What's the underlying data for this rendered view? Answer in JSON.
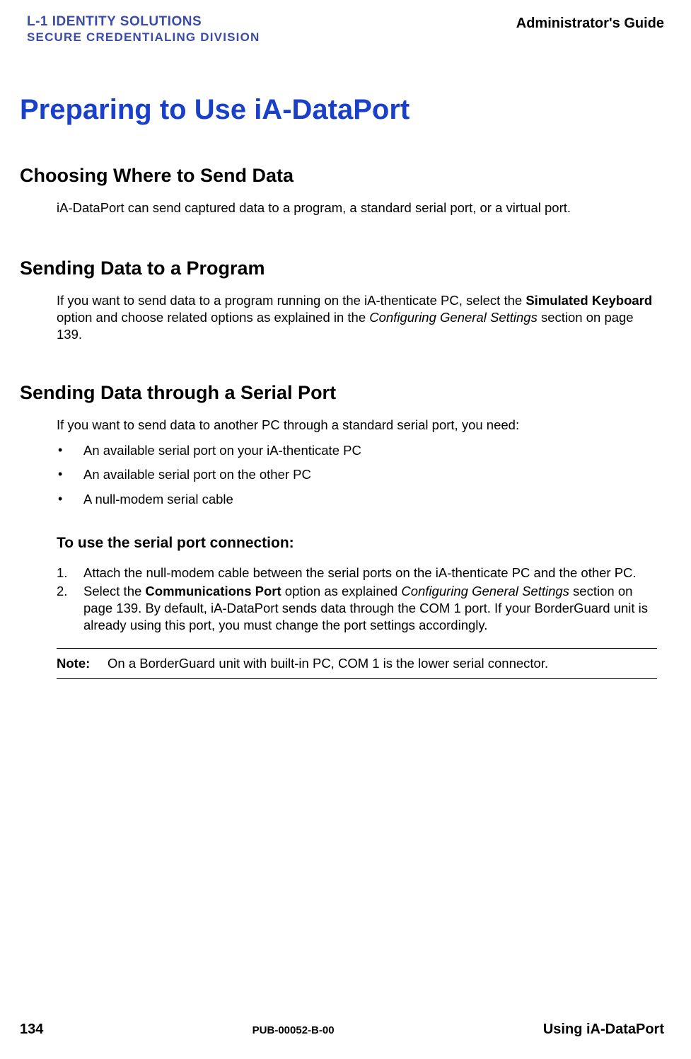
{
  "header": {
    "logo_line1_a": "L-1 ",
    "logo_line1_b": "IDENTITY SOLUTIONS",
    "logo_line2": "SECURE CREDENTIALING DIVISION",
    "right": "Administrator's Guide"
  },
  "title": "Preparing to Use iA-DataPort",
  "sections": {
    "s1": {
      "heading": "Choosing Where to Send Data",
      "p1": "iA-DataPort can send captured data to a program,  a standard serial port, or a virtual port."
    },
    "s2": {
      "heading": "Sending Data to a Program",
      "p1a": "If you want to send data to a program running on the iA-thenticate PC, select the ",
      "p1b": "Simulated Keyboard",
      "p1c": " option and choose related options as explained in the ",
      "p1d": "Configuring General Settings",
      "p1e": " section on page 139."
    },
    "s3": {
      "heading": "Sending Data through a Serial Port",
      "p1": "If you want to send data to another PC through a standard serial port, you need:",
      "bullets": {
        "b1": "An available serial port on your iA-thenticate PC",
        "b2": "An available serial port on the other PC",
        "b3": "A null-modem  serial cable"
      },
      "sub_heading": "To use the serial port connection:",
      "steps": {
        "n1": "1.",
        "t1": "Attach the null-modem cable between the serial ports on the iA-thenticate PC and the other PC.",
        "n2": "2.",
        "t2a": "Select the ",
        "t2b": "Communications Port",
        "t2c": " option as explained ",
        "t2d": "Configuring General Settings",
        "t2e": " section on page 139. By default, iA-DataPort sends data through the COM 1 port. If your BorderGuard unit is already using this port, you must change the port settings accordingly."
      },
      "note_label": "Note:",
      "note_text": "On a BorderGuard unit with built-in PC, COM 1 is the lower serial connector."
    }
  },
  "footer": {
    "left": "134",
    "center": "PUB-00052-B-00",
    "right": "Using iA-DataPort"
  }
}
